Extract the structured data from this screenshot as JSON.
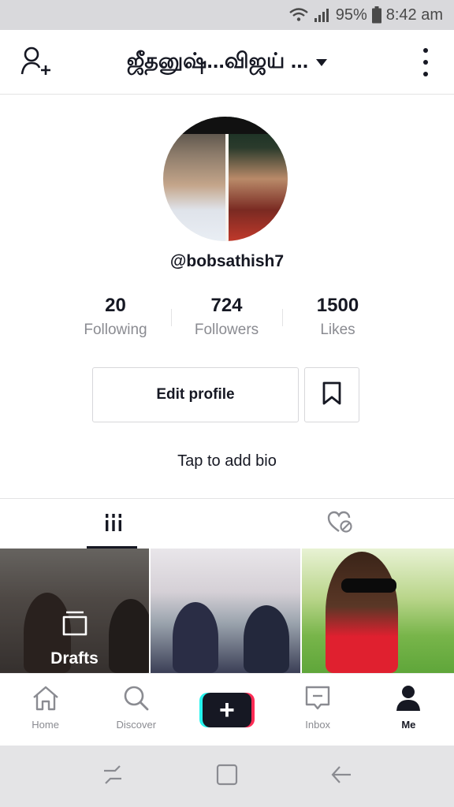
{
  "status_bar": {
    "battery": "95%",
    "time": "8:42 am"
  },
  "header": {
    "title": "ஜீதனுஷ்...விஜய் ..."
  },
  "profile": {
    "username": "@bobsathish7",
    "stats": [
      {
        "value": "20",
        "label": "Following"
      },
      {
        "value": "724",
        "label": "Followers"
      },
      {
        "value": "1500",
        "label": "Likes"
      }
    ],
    "edit_label": "Edit profile",
    "bio": "Tap to add bio"
  },
  "grid": {
    "drafts_label": "Drafts"
  },
  "bottom_nav": [
    {
      "label": "Home",
      "icon": "home-icon"
    },
    {
      "label": "Discover",
      "icon": "search-icon"
    },
    {
      "label": "",
      "icon": "plus-icon"
    },
    {
      "label": "Inbox",
      "icon": "inbox-icon"
    },
    {
      "label": "Me",
      "icon": "person-icon"
    }
  ],
  "colors": {
    "accent_cyan": "#25f4ee",
    "accent_red": "#fe2c55",
    "text_primary": "#161823",
    "text_secondary": "#8a8b91"
  }
}
